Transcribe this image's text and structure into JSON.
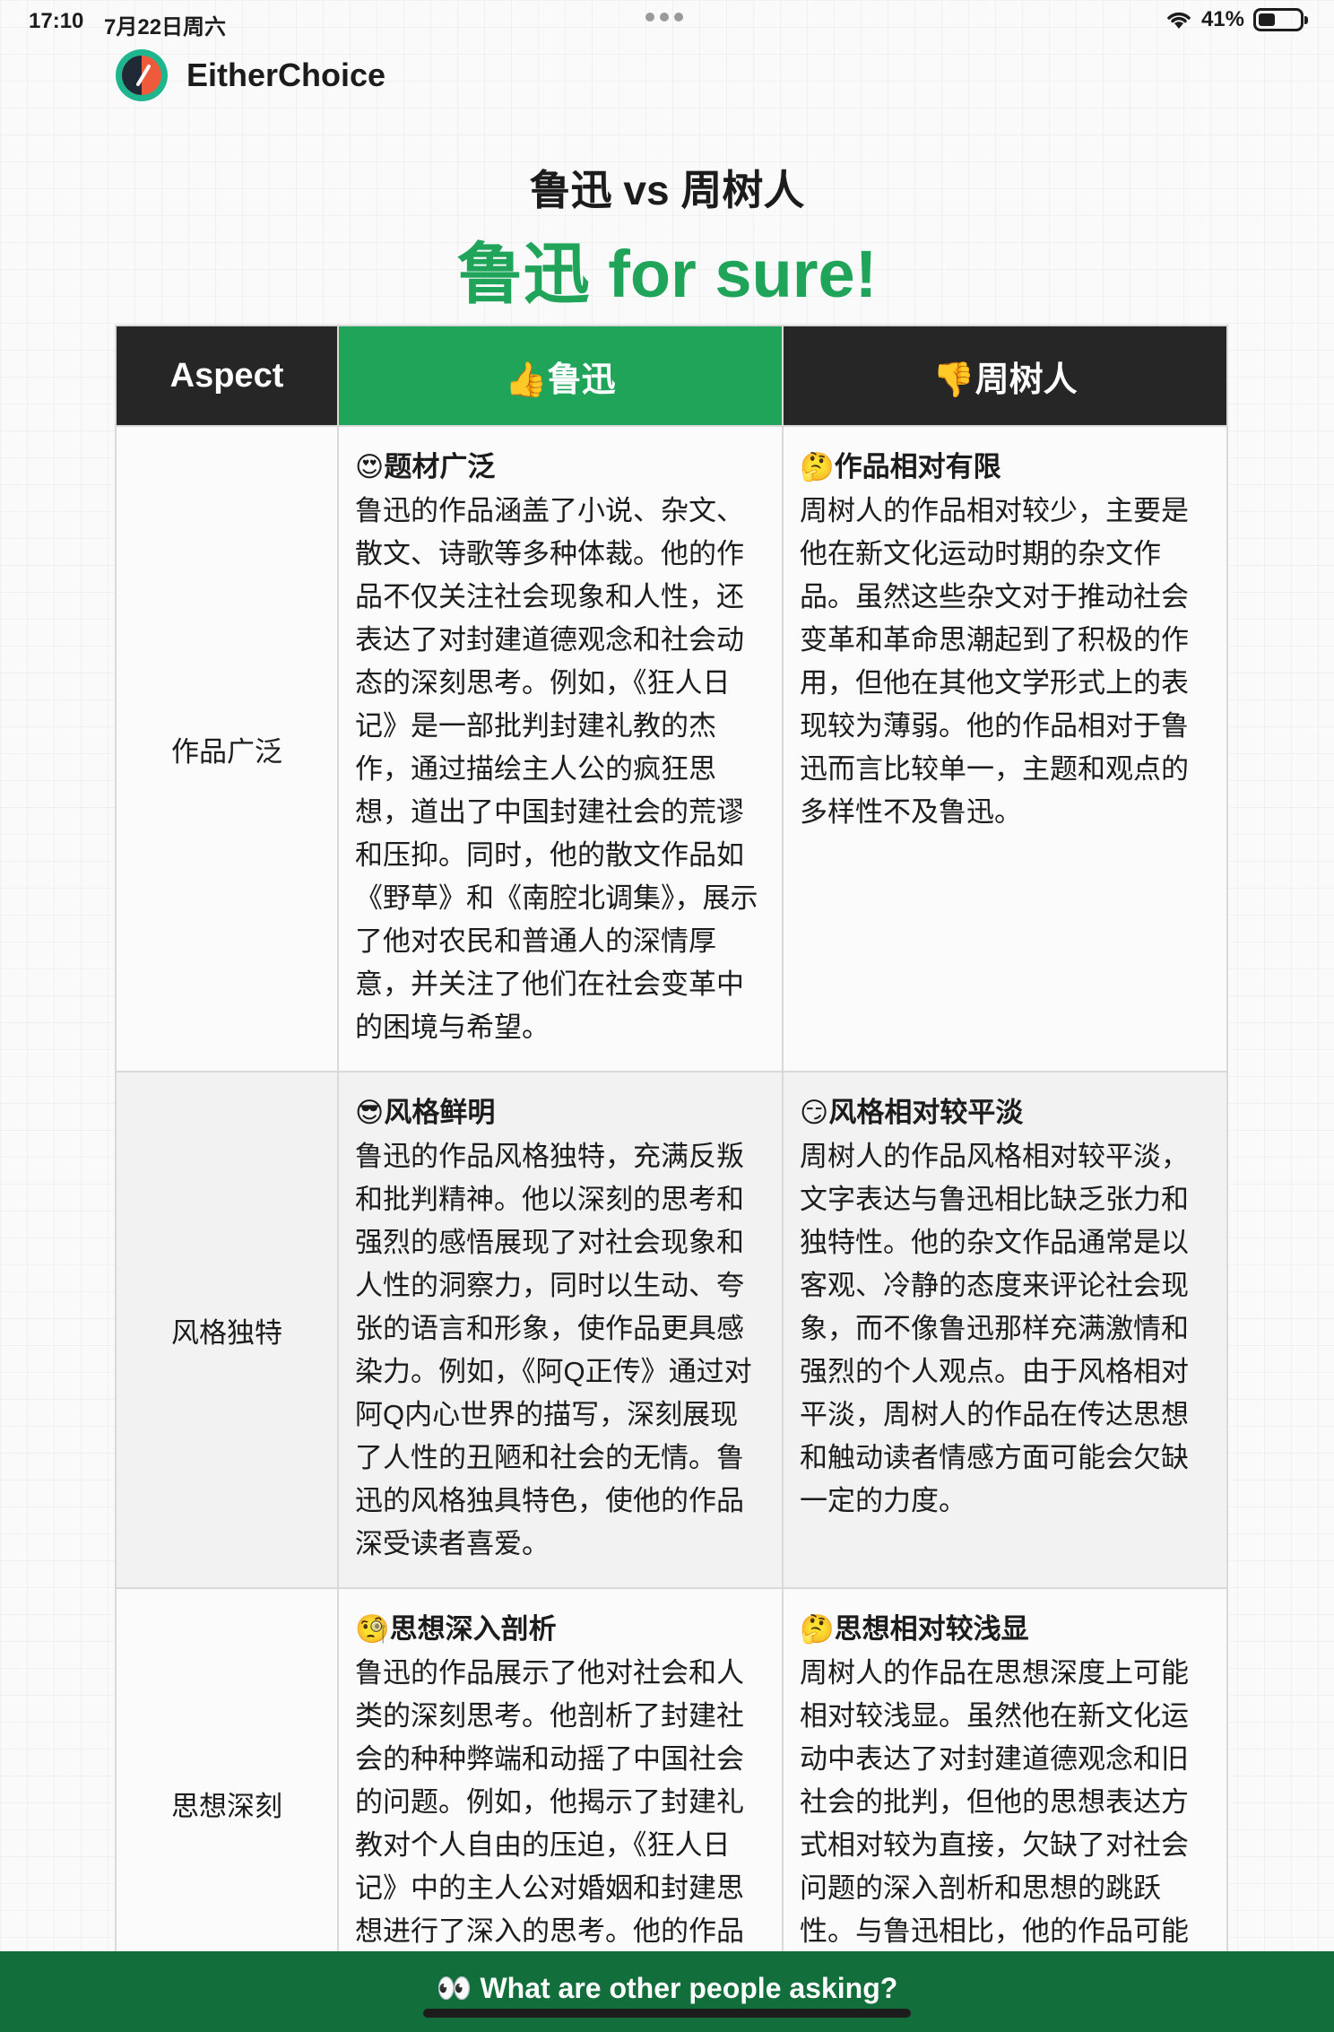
{
  "status": {
    "time": "17:10",
    "date": "7月22日周六",
    "battery": "41%",
    "battery_level": 0.41
  },
  "brand": {
    "name": "EitherChoice",
    "icon": "compass-logo-icon"
  },
  "heading": "鲁迅 vs 周树人",
  "verdict": "鲁迅 for sure!",
  "table": {
    "headers": {
      "aspect": "Aspect",
      "winner": "👍鲁迅",
      "loser": "👎周树人"
    },
    "rows": [
      {
        "aspect": "作品广泛",
        "winner_title": "😍题材广泛",
        "winner_text": "鲁迅的作品涵盖了小说、杂文、散文、诗歌等多种体裁。他的作品不仅关注社会现象和人性，还表达了对封建道德观念和社会动态的深刻思考。例如，《狂人日记》是一部批判封建礼教的杰作，通过描绘主人公的疯狂思想，道出了中国封建社会的荒谬和压抑。同时，他的散文作品如《野草》和《南腔北调集》，展示了他对农民和普通人的深情厚意，并关注了他们在社会变革中的困境与希望。",
        "loser_title": "🤔作品相对有限",
        "loser_text": "周树人的作品相对较少，主要是他在新文化运动时期的杂文作品。虽然这些杂文对于推动社会变革和革命思潮起到了积极的作用，但他在其他文学形式上的表现较为薄弱。他的作品相对于鲁迅而言比较单一，主题和观点的多样性不及鲁迅。"
      },
      {
        "aspect": "风格独特",
        "winner_title": "😎风格鲜明",
        "winner_text": "鲁迅的作品风格独特，充满反叛和批判精神。他以深刻的思考和强烈的感悟展现了对社会现象和人性的洞察力，同时以生动、夸张的语言和形象，使作品更具感染力。例如，《阿Q正传》通过对阿Q内心世界的描写，深刻展现了人性的丑陋和社会的无情。鲁迅的风格独具特色，使他的作品深受读者喜爱。",
        "loser_title": "😏风格相对较平淡",
        "loser_text": "周树人的作品风格相对较平淡，文字表达与鲁迅相比缺乏张力和独特性。他的杂文作品通常是以客观、冷静的态度来评论社会现象，而不像鲁迅那样充满激情和强烈的个人观点。由于风格相对平淡，周树人的作品在传达思想和触动读者情感方面可能会欠缺一定的力度。"
      },
      {
        "aspect": "思想深刻",
        "winner_title": "🧐思想深入剖析",
        "winner_text": "鲁迅的作品展示了他对社会和人类的深刻思考。他剖析了封建社会的种种弊端和动摇了中国社会的问题。例如，他揭示了封建礼教对个人自由的压迫，《狂人日记》中的主人公对婚姻和封建思想进行了深入的思考。他的作品不仅反映了他对中国社会的清醒",
        "loser_title": "🤔思想相对较浅显",
        "loser_text": "周树人的作品在思想深度上可能相对较浅显。虽然他在新文化运动中表达了对封建道德观念和旧社会的批判，但他的思想表达方式相对较为直接，欠缺了对社会问题的深入剖析和思想的跳跃性。与鲁迅相比，他的作品可能相对较缺乏触动和引发读者思考"
      }
    ]
  },
  "bottom_bar": {
    "label": "👀 What are other people asking?"
  },
  "colors": {
    "accent": "#1fa45a",
    "dark": "#262626",
    "bottom_bar": "#126e3a"
  }
}
